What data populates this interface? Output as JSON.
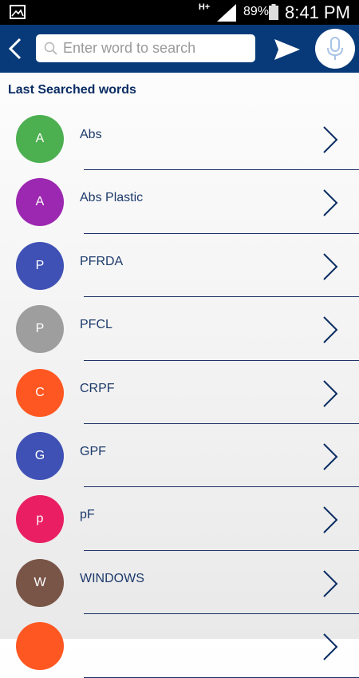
{
  "status_bar": {
    "network": "H+",
    "battery": "89%",
    "time": "8:41 PM",
    "icons": [
      "gallery-icon",
      "signal-icon",
      "battery-icon"
    ]
  },
  "toolbar": {
    "search_placeholder": "Enter word to search",
    "search_value": "",
    "icons": [
      "back-icon",
      "search-icon",
      "send-icon",
      "mic-icon"
    ],
    "background": "#083a79"
  },
  "section_title": "Last Searched words",
  "recent_words": [
    {
      "initial": "A",
      "word": "Abs",
      "color": "#4caf50"
    },
    {
      "initial": "A",
      "word": "Abs Plastic",
      "color": "#9c27b0"
    },
    {
      "initial": "P",
      "word": "PFRDA",
      "color": "#3f51b5"
    },
    {
      "initial": "P",
      "word": "PFCL",
      "color": "#9e9e9e"
    },
    {
      "initial": "C",
      "word": "CRPF",
      "color": "#ff5722"
    },
    {
      "initial": "G",
      "word": "GPF",
      "color": "#3f51b5"
    },
    {
      "initial": "p",
      "word": "pF",
      "color": "#e91e63"
    },
    {
      "initial": "W",
      "word": "WINDOWS",
      "color": "#795548"
    },
    {
      "initial": "",
      "word": "",
      "color": "#ff5722"
    }
  ]
}
